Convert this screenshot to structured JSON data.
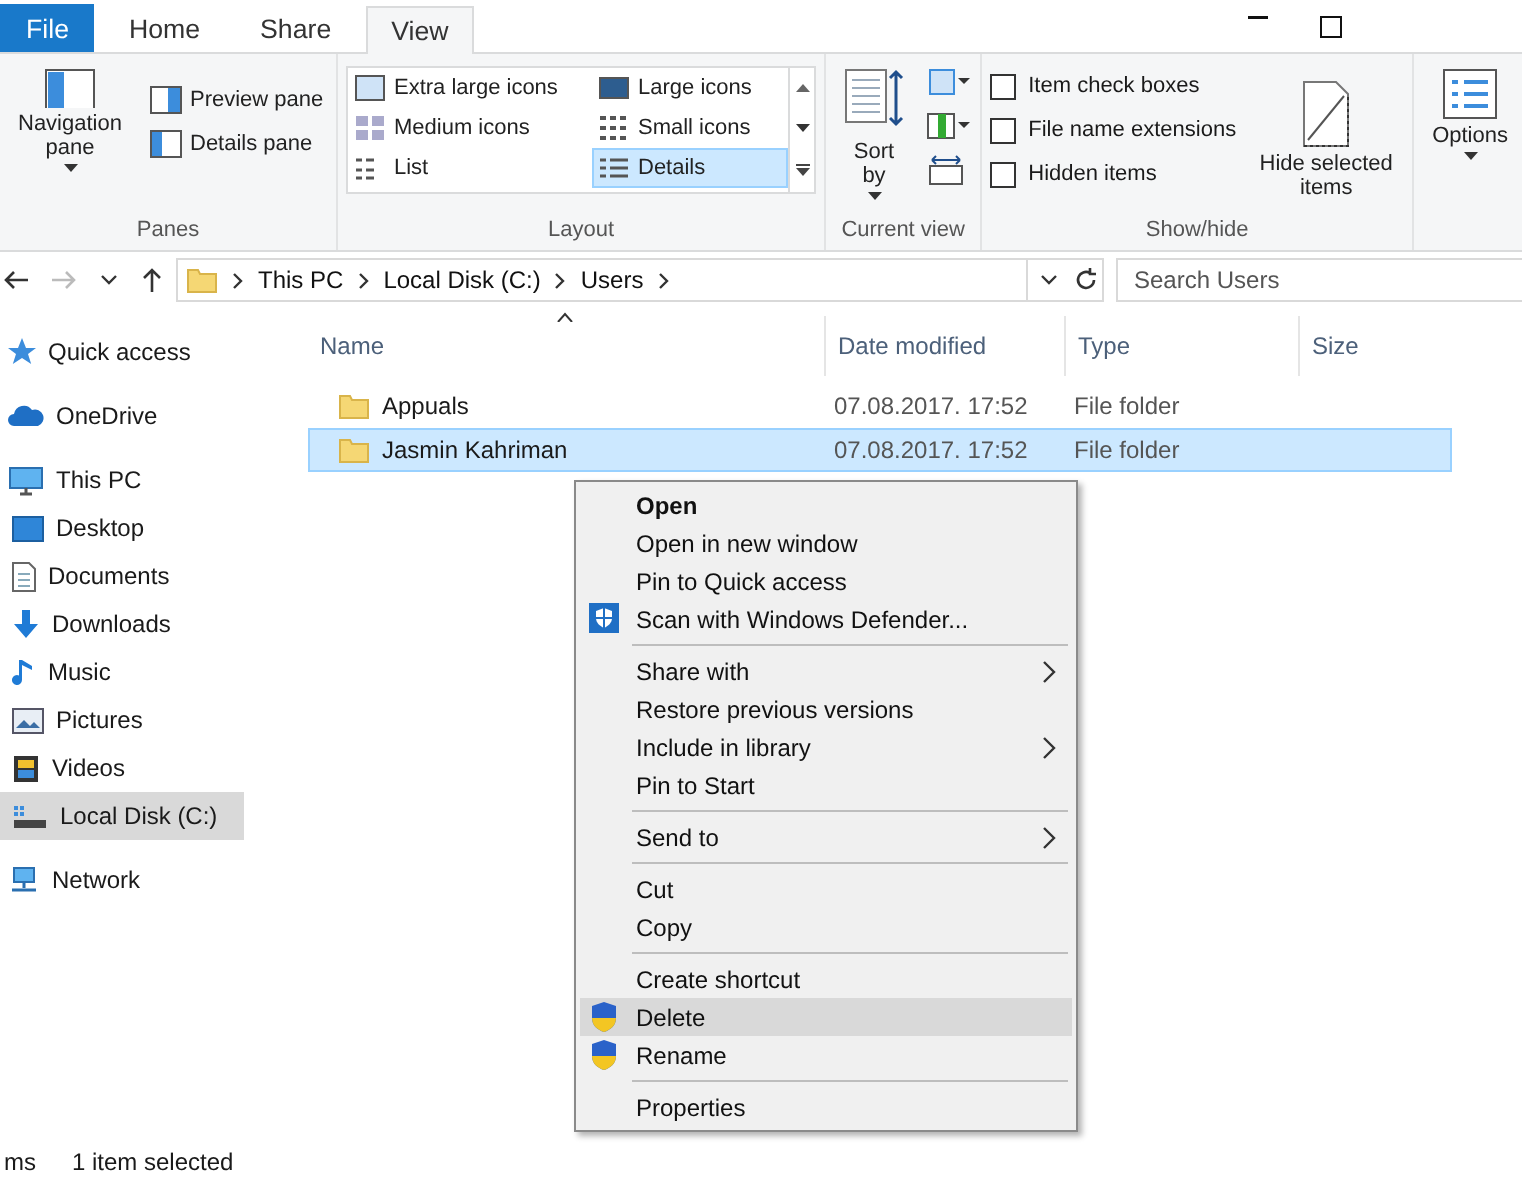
{
  "window": {
    "tabs": [
      {
        "label": "File",
        "selected": false
      },
      {
        "label": "Home",
        "selected": false
      },
      {
        "label": "Share",
        "selected": false
      },
      {
        "label": "View",
        "selected": true
      }
    ]
  },
  "ribbon": {
    "panes": {
      "title": "Panes",
      "navigation_pane": "Navigation pane",
      "preview_pane": "Preview pane",
      "details_pane": "Details pane"
    },
    "layout": {
      "title": "Layout",
      "options": [
        {
          "label": "Extra large icons",
          "selected": false
        },
        {
          "label": "Large icons",
          "selected": false
        },
        {
          "label": "Medium icons",
          "selected": false
        },
        {
          "label": "Small icons",
          "selected": false
        },
        {
          "label": "List",
          "selected": false
        },
        {
          "label": "Details",
          "selected": true
        }
      ]
    },
    "current_view": {
      "title": "Current view",
      "sort_by": "Sort by"
    },
    "show_hide": {
      "title": "Show/hide",
      "checkboxes": [
        {
          "label": "Item check boxes",
          "checked": false
        },
        {
          "label": "File name extensions",
          "checked": false
        },
        {
          "label": "Hidden items",
          "checked": false
        }
      ],
      "hide_selected": "Hide selected items"
    },
    "options": {
      "label": "Options"
    }
  },
  "address_bar": {
    "crumbs": [
      "This PC",
      "Local Disk (C:)",
      "Users"
    ]
  },
  "search": {
    "placeholder": "Search Users"
  },
  "sidebar": {
    "items": [
      {
        "label": "Quick access",
        "selected": false
      },
      {
        "label": "OneDrive",
        "selected": false
      },
      {
        "label": "This PC",
        "selected": false,
        "children": [
          {
            "label": "Desktop",
            "selected": false
          },
          {
            "label": "Documents",
            "selected": false
          },
          {
            "label": "Downloads",
            "selected": false
          },
          {
            "label": "Music",
            "selected": false
          },
          {
            "label": "Pictures",
            "selected": false
          },
          {
            "label": "Videos",
            "selected": false
          },
          {
            "label": "Local Disk (C:)",
            "selected": true
          }
        ]
      },
      {
        "label": "Network",
        "selected": false
      }
    ]
  },
  "file_list": {
    "columns": [
      "Name",
      "Date modified",
      "Type",
      "Size"
    ],
    "rows": [
      {
        "name": "Appuals",
        "date_modified": "07.08.2017. 17:52",
        "type": "File folder",
        "selected": false
      },
      {
        "name": "Jasmin Kahriman",
        "date_modified": "07.08.2017. 17:52",
        "type": "File folder",
        "selected": true
      }
    ]
  },
  "context_menu": {
    "items": [
      {
        "kind": "plain",
        "label": "Open",
        "default": true,
        "submenu": false,
        "selected": false
      },
      {
        "kind": "plain",
        "label": "Open in new window",
        "default": false,
        "submenu": false,
        "selected": false
      },
      {
        "kind": "plain",
        "label": "Pin to Quick access",
        "default": false,
        "submenu": false,
        "selected": false
      },
      {
        "kind": "scan",
        "label": "Scan with Windows Defender...",
        "default": false,
        "submenu": false,
        "selected": false
      },
      {
        "kind": "separator"
      },
      {
        "kind": "plain",
        "label": "Share with",
        "default": false,
        "submenu": true,
        "selected": false
      },
      {
        "kind": "plain",
        "label": "Restore previous versions",
        "default": false,
        "submenu": false,
        "selected": false
      },
      {
        "kind": "plain",
        "label": "Include in library",
        "default": false,
        "submenu": true,
        "selected": false
      },
      {
        "kind": "plain",
        "label": "Pin to Start",
        "default": false,
        "submenu": false,
        "selected": false
      },
      {
        "kind": "separator"
      },
      {
        "kind": "plain",
        "label": "Send to",
        "default": false,
        "submenu": true,
        "selected": false
      },
      {
        "kind": "separator"
      },
      {
        "kind": "plain",
        "label": "Cut",
        "default": false,
        "submenu": false,
        "selected": false
      },
      {
        "kind": "plain",
        "label": "Copy",
        "default": false,
        "submenu": false,
        "selected": false
      },
      {
        "kind": "separator"
      },
      {
        "kind": "plain",
        "label": "Create shortcut",
        "default": false,
        "submenu": false,
        "selected": false
      },
      {
        "kind": "elevated",
        "label": "Delete",
        "default": false,
        "submenu": false,
        "selected": true
      },
      {
        "kind": "elevated",
        "label": "Rename",
        "default": false,
        "submenu": false,
        "selected": false
      },
      {
        "kind": "separator"
      },
      {
        "kind": "plain",
        "label": "Properties",
        "default": false,
        "submenu": false,
        "selected": false
      }
    ]
  },
  "status_bar": {
    "item_count": "ms",
    "selection": "1 item selected"
  }
}
